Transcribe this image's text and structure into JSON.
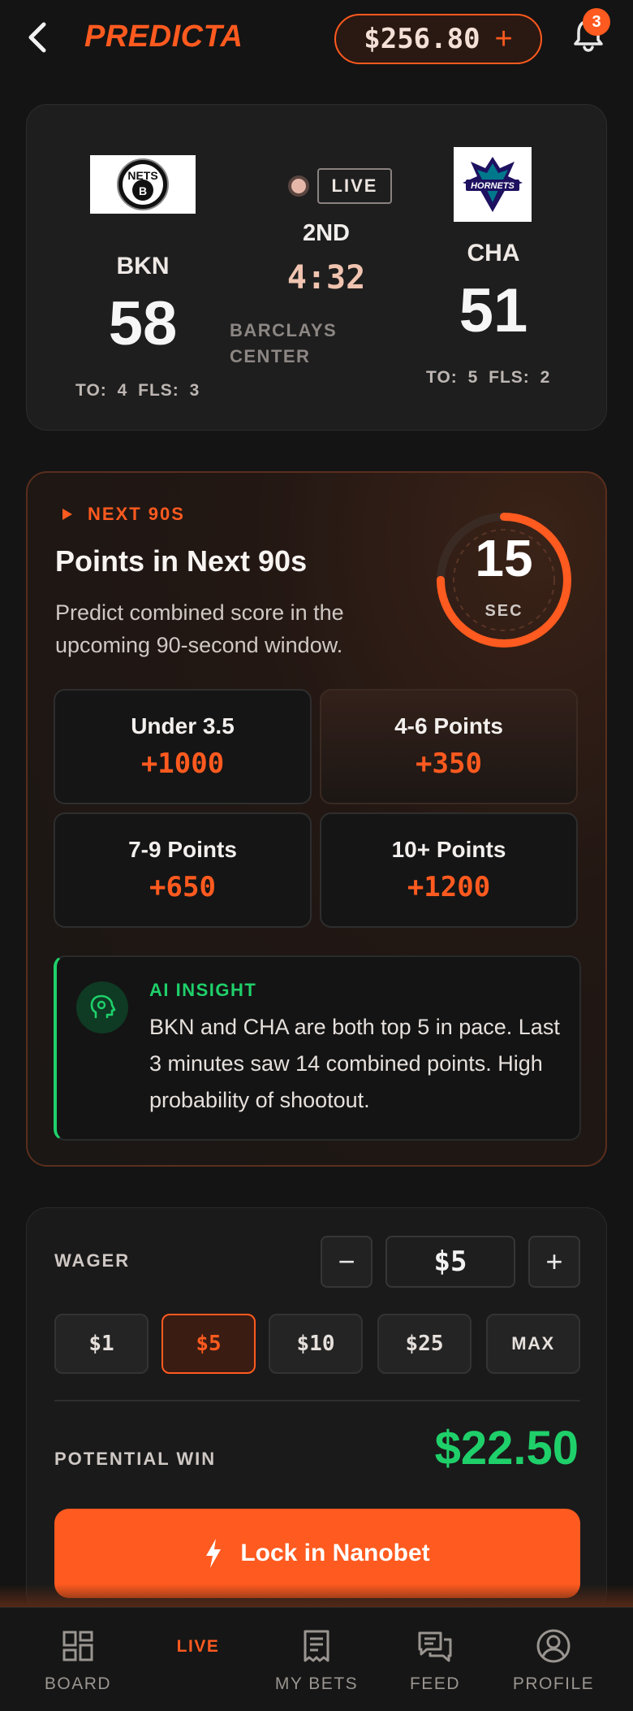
{
  "header": {
    "brand": "PREDICTA",
    "balance": "$256.80",
    "balance_add": "+",
    "notification_count": "3"
  },
  "game": {
    "home": {
      "abbr": "BKN",
      "score": "58",
      "logo_text": "NETS",
      "stats": "TO: 4   FLS: 3"
    },
    "away": {
      "abbr": "CHA",
      "score": "51",
      "logo_text": "HORNETS",
      "stats": "TO: 5   FLS: 2"
    },
    "status": "LIVE",
    "quarter": "2ND",
    "clock": "4:32",
    "venue": "BARCLAYS CENTER"
  },
  "market": {
    "tag": "NEXT 90S",
    "title": "Points in Next 90s",
    "description": "Predict combined score in the upcoming 90-second window.",
    "timer_value": "15",
    "timer_unit": "SEC",
    "timer_fraction_remaining": 0.75,
    "options": [
      {
        "label": "Under 3.5",
        "odds": "+1000"
      },
      {
        "label": "4-6 Points",
        "odds": "+350"
      },
      {
        "label": "7-9 Points",
        "odds": "+650"
      },
      {
        "label": "10+ Points",
        "odds": "+1200"
      }
    ],
    "insight": {
      "tag": "AI INSIGHT",
      "text": "BKN and CHA are both top 5 in pace. Last 3 minutes saw 14 combined points. High probability of shootout."
    }
  },
  "wager": {
    "label": "WAGER",
    "minus": "−",
    "plus": "+",
    "value": "$5",
    "chips": [
      "$1",
      "$5",
      "$10",
      "$25",
      "MAX"
    ],
    "selected_chip": "$5",
    "potential_label": "POTENTIAL WIN",
    "potential_value": "$22.50",
    "cta": "Lock in Nanobet"
  },
  "nav": {
    "items": [
      "BOARD",
      "LIVE",
      "MY BETS",
      "FEED",
      "PROFILE"
    ],
    "active": "LIVE"
  },
  "colors": {
    "accent": "#ff5a1f",
    "positive": "#1fd06a",
    "background": "#141414"
  }
}
